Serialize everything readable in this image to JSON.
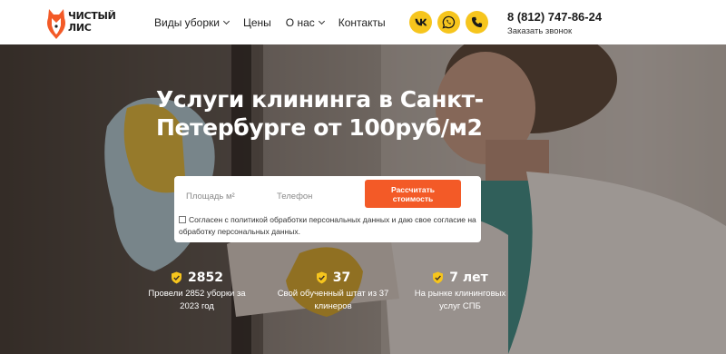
{
  "brand": {
    "logo_text": "ЧИСТЫЙ\nЛИС",
    "accent": "#f35a27",
    "yellow": "#f6c51d"
  },
  "nav": {
    "items": [
      {
        "label": "Виды уборки",
        "has_dropdown": true
      },
      {
        "label": "Цены",
        "has_dropdown": false
      },
      {
        "label": "О нас",
        "has_dropdown": true
      },
      {
        "label": "Контакты",
        "has_dropdown": false
      }
    ]
  },
  "social": {
    "icons": [
      "vk-icon",
      "whatsapp-icon",
      "phone-icon"
    ]
  },
  "contact": {
    "phone": "8 (812) 747-86-24",
    "callback": "Заказать звонок"
  },
  "hero": {
    "title": "Услуги клининга в Санкт-Петербурге от 100руб/м2",
    "form": {
      "area_placeholder": "Площадь м²",
      "phone_placeholder": "Телефон",
      "button": "Рассчитать стоимость",
      "consent": "Согласен с политикой обработки персональных данных и даю свое согласие на обработку персональных данных."
    },
    "stats": [
      {
        "value": "2852",
        "text": "Провели 2852 уборки за 2023 год"
      },
      {
        "value": "37",
        "text": "Свой обученный штат из 37 клинеров"
      },
      {
        "value": "7 лет",
        "text": "На рынке клининговых услуг СПБ"
      }
    ]
  }
}
